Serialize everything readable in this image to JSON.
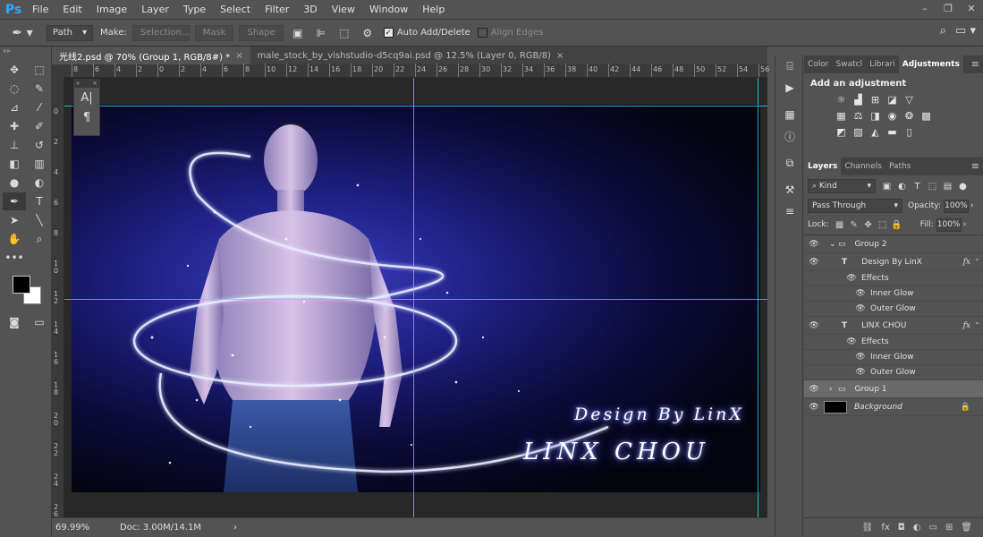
{
  "app": {
    "logo": "Ps",
    "colors": {
      "accent": "#31a8ff",
      "guide": "#2ee6ff"
    }
  },
  "menu": [
    "File",
    "Edit",
    "Image",
    "Layer",
    "Type",
    "Select",
    "Filter",
    "3D",
    "View",
    "Window",
    "Help"
  ],
  "window_controls": {
    "minimize": "–",
    "restore": "❐",
    "close": "✕"
  },
  "options": {
    "tool_icon": "pen-icon",
    "mode_value": "Path",
    "make_label": "Make:",
    "selection_button": "Selection...",
    "mask_button": "Mask",
    "shape_button": "Shape",
    "auto_add_delete": "Auto Add/Delete",
    "align_edges": "Align Edges"
  },
  "document_tabs": [
    {
      "title": "光线2.psd @ 70% (Group 1, RGB/8#) *",
      "active": true
    },
    {
      "title": "male_stock_by_vishstudio-d5cq9ai.psd @ 12.5% (Layer 0, RGB/8)",
      "active": false
    }
  ],
  "ruler": {
    "top": [
      "8",
      "6",
      "4",
      "2",
      "0",
      "2",
      "4",
      "6",
      "8",
      "10",
      "12",
      "14",
      "16",
      "18",
      "20",
      "22",
      "24",
      "26",
      "28",
      "30",
      "32",
      "34",
      "36",
      "38",
      "40",
      "42",
      "44",
      "46",
      "48",
      "50",
      "52",
      "54",
      "56",
      "4"
    ],
    "left": [
      {
        "digits": [
          "0"
        ]
      },
      {
        "digits": [
          "2"
        ]
      },
      {
        "digits": [
          "4"
        ]
      },
      {
        "digits": [
          "6"
        ]
      },
      {
        "digits": [
          "8"
        ]
      },
      {
        "digits": [
          "1",
          "0"
        ]
      },
      {
        "digits": [
          "1",
          "2"
        ]
      },
      {
        "digits": [
          "1",
          "4"
        ]
      },
      {
        "digits": [
          "1",
          "6"
        ]
      },
      {
        "digits": [
          "1",
          "8"
        ]
      },
      {
        "digits": [
          "2",
          "0"
        ]
      },
      {
        "digits": [
          "2",
          "2"
        ]
      },
      {
        "digits": [
          "2",
          "4"
        ]
      },
      {
        "digits": [
          "2",
          "6"
        ]
      }
    ]
  },
  "canvas": {
    "signature_small": "Design By LinX",
    "signature_large": "LINX CHOU"
  },
  "float_panel": {
    "btn1": "A|",
    "btn2": "¶"
  },
  "status": {
    "zoom": "69.99%",
    "doc": "Doc: 3.00M/14.1M",
    "arrow": "›"
  },
  "panels": {
    "top_tabs": [
      {
        "label": "Color",
        "active": false
      },
      {
        "label": "Swatcl",
        "active": false
      },
      {
        "label": "Librari",
        "active": false
      },
      {
        "label": "Adjustments",
        "active": true
      }
    ],
    "adjustments_title": "Add an adjustment",
    "layer_tabs": [
      {
        "label": "Layers",
        "active": true
      },
      {
        "label": "Channels",
        "active": false
      },
      {
        "label": "Paths",
        "active": false
      }
    ],
    "filter_kind": "Kind",
    "blend_mode": "Pass Through",
    "opacity_label": "Opacity:",
    "opacity_value": "100%",
    "lock_label": "Lock:",
    "fill_label": "Fill:",
    "fill_value": "100%",
    "layers": [
      {
        "name": "Group 2",
        "type": "group",
        "indent": 0,
        "expanded": true
      },
      {
        "name": "Design By LinX",
        "type": "text",
        "indent": 1,
        "fx": true
      },
      {
        "name": "Effects",
        "type": "effects",
        "indent": 2
      },
      {
        "name": "Inner Glow",
        "type": "effect",
        "indent": 3
      },
      {
        "name": "Outer Glow",
        "type": "effect",
        "indent": 3
      },
      {
        "name": "LINX CHOU",
        "type": "text",
        "indent": 1,
        "fx": true
      },
      {
        "name": "Effects",
        "type": "effects",
        "indent": 2
      },
      {
        "name": "Inner Glow",
        "type": "effect",
        "indent": 3
      },
      {
        "name": "Outer Glow",
        "type": "effect",
        "indent": 3
      },
      {
        "name": "Group 1",
        "type": "group",
        "indent": 0,
        "expanded": false,
        "selected": true
      },
      {
        "name": "Background",
        "type": "background",
        "indent": 0,
        "locked": true
      }
    ]
  }
}
